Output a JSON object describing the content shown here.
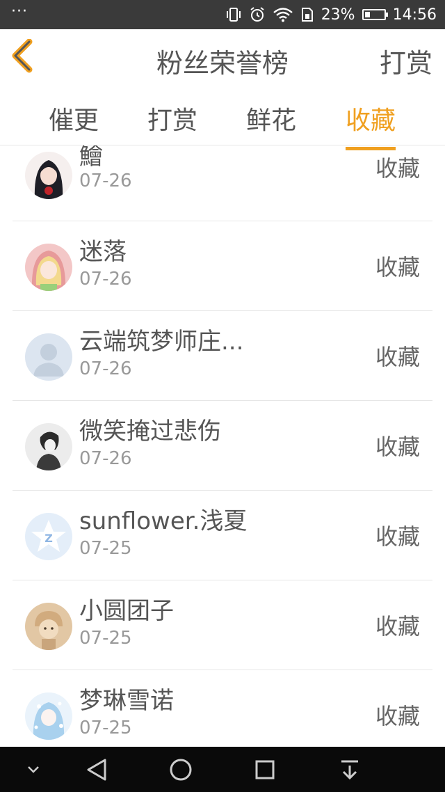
{
  "status_bar": {
    "dots": "···",
    "battery_percent": "23%",
    "time": "14:56",
    "battery_level": 0.23
  },
  "header": {
    "title": "粉丝荣誉榜",
    "action_label": "打赏"
  },
  "tabs": [
    {
      "label": "催更",
      "active": false
    },
    {
      "label": "打赏",
      "active": false
    },
    {
      "label": "鲜花",
      "active": false
    },
    {
      "label": "收藏",
      "active": true
    }
  ],
  "accent_color": "#f0a020",
  "items": [
    {
      "name": "鱠",
      "date": "07-26",
      "action": "收藏",
      "avatar": "anime-girl-dark-hair"
    },
    {
      "name": "迷落",
      "date": "07-26",
      "action": "收藏",
      "avatar": "anime-girl-blonde"
    },
    {
      "name": "云端筑梦师庄...",
      "date": "07-26",
      "action": "收藏",
      "avatar": "default-user"
    },
    {
      "name": "微笑掩过悲伤",
      "date": "07-26",
      "action": "收藏",
      "avatar": "sketch-boy"
    },
    {
      "name": "sunflower.浅夏",
      "date": "07-25",
      "action": "收藏",
      "avatar": "qq-star"
    },
    {
      "name": "小圆团子",
      "date": "07-25",
      "action": "收藏",
      "avatar": "cartoon-child"
    },
    {
      "name": "梦琳雪诺",
      "date": "07-25",
      "action": "收藏",
      "avatar": "anime-snow"
    }
  ]
}
